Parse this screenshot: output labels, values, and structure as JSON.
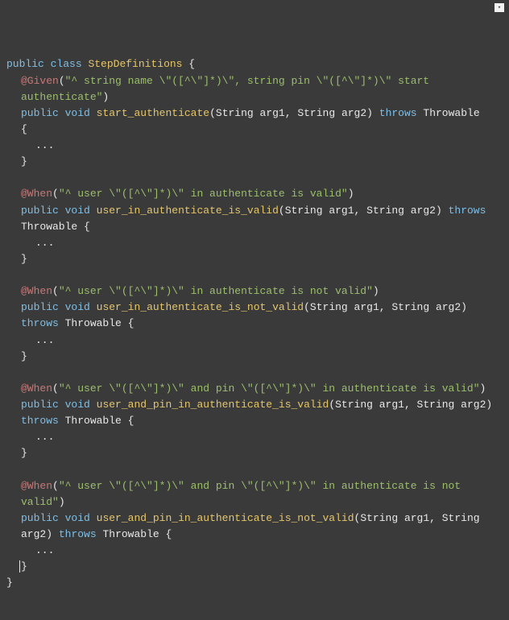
{
  "menu_glyph": "▾",
  "tokens": {
    "public": "public",
    "class": "class",
    "void": "void",
    "throws": "throws",
    "class_name": "StepDefinitions",
    "throwable": "Throwable",
    "string_type": "String",
    "arg1": "arg1",
    "arg2": "arg2",
    "comma_sp": ", ",
    "lparen": "(",
    "rparen": ")",
    "lbrace": "{",
    "rbrace": "}",
    "dots": "...",
    "sp": " "
  },
  "methods": [
    {
      "ann": "@Given",
      "str": "\"^ string name \\\"([^\\\"]*)\\\", string pin \\\"([^\\\"]*)\\\" start authenticate\"",
      "name": "start_authenticate",
      "first_brace_wide": true
    },
    {
      "ann": "@When",
      "str": "\"^ user \\\"([^\\\"]*)\\\" in authenticate is valid\"",
      "name": "user_in_authenticate_is_valid",
      "first_brace_wide": false
    },
    {
      "ann": "@When",
      "str": "\"^ user \\\"([^\\\"]*)\\\" in authenticate is not valid\"",
      "name": "user_in_authenticate_is_not_valid",
      "first_brace_wide": false
    },
    {
      "ann": "@When",
      "str": "\"^ user \\\"([^\\\"]*)\\\" and pin \\\"([^\\\"]*)\\\" in authenticate is valid\"",
      "name": "user_and_pin_in_authenticate_is_valid",
      "first_brace_wide": false
    },
    {
      "ann": "@When",
      "str": "\"^ user \\\"([^\\\"]*)\\\" and pin \\\"([^\\\"]*)\\\" in authenticate is not valid\"",
      "name": "user_and_pin_in_authenticate_is_not_valid",
      "first_brace_wide": false
    }
  ]
}
